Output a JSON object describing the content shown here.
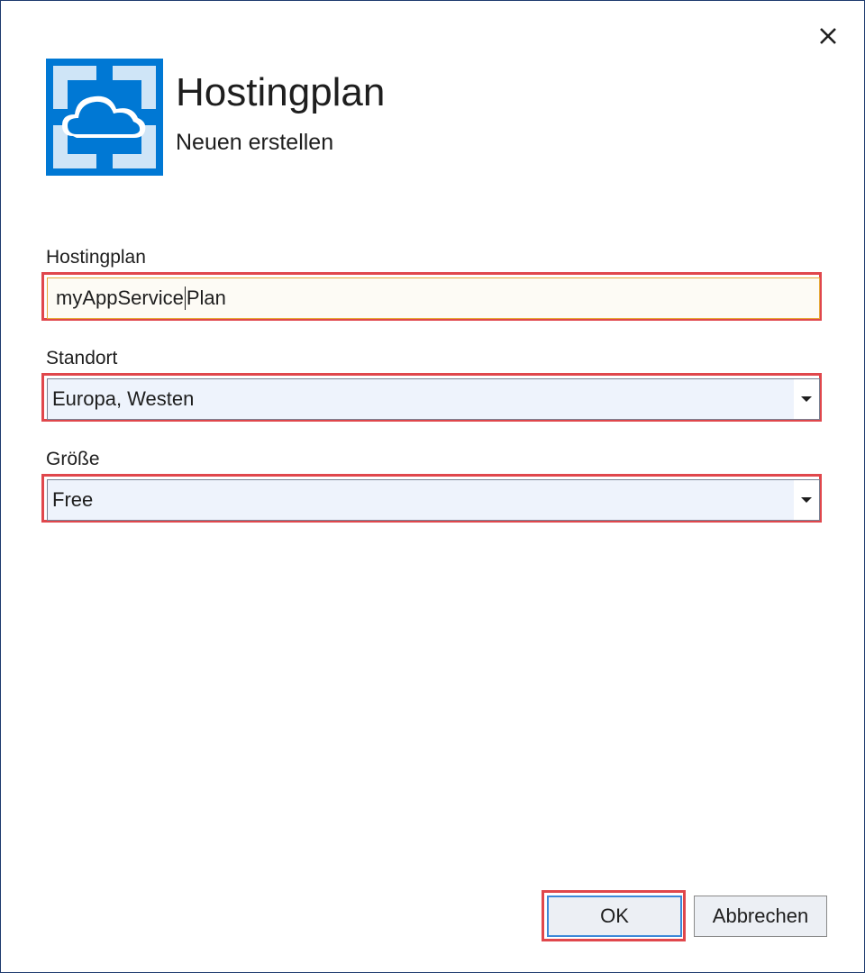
{
  "dialog": {
    "title": "Hostingplan",
    "subtitle": "Neuen erstellen",
    "close_label": "✕",
    "icon": "azure-app-service-icon"
  },
  "fields": {
    "hosting_plan": {
      "label": "Hostingplan",
      "value_before_caret": "myAppService",
      "value_after_caret": "Plan"
    },
    "location": {
      "label": "Standort",
      "value": "Europa, Westen"
    },
    "size": {
      "label": "Größe",
      "value": "Free"
    }
  },
  "buttons": {
    "ok": "OK",
    "cancel": "Abbrechen"
  },
  "colors": {
    "highlight": "#e0474c",
    "azure_blue": "#0078d4",
    "focus_border": "#e5a93a"
  }
}
